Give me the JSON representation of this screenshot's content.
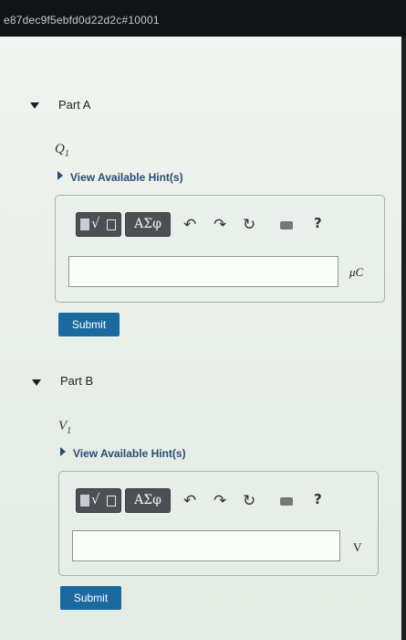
{
  "topbar": {
    "hash_text": "e87dec9f5ebfd0d22d2c#10001"
  },
  "parts": [
    {
      "title": "Part A",
      "variable_letter": "Q",
      "variable_sub": "1",
      "hint_label": "View Available Hint(s)",
      "toolbar": {
        "greek_label": "ΑΣφ",
        "help_label": "?"
      },
      "answer_value": "",
      "unit": "μC",
      "submit_label": "Submit"
    },
    {
      "title": "Part B",
      "variable_letter": "V",
      "variable_sub": "1",
      "hint_label": "View Available Hint(s)",
      "toolbar": {
        "greek_label": "ΑΣφ",
        "help_label": "?"
      },
      "answer_value": "",
      "unit": "V",
      "submit_label": "Submit"
    }
  ],
  "icons": {
    "toggle": "chevron-down-icon",
    "hint": "triangle-right-icon",
    "templates": "templates-icon",
    "undo": "undo-icon",
    "redo": "redo-icon",
    "reset": "reset-icon",
    "keyboard": "keyboard-icon",
    "help": "help-icon"
  },
  "colors": {
    "submit": "#1a6aa0",
    "hint_link": "#2a4d73",
    "toolbar_button": "#4c4f53"
  }
}
